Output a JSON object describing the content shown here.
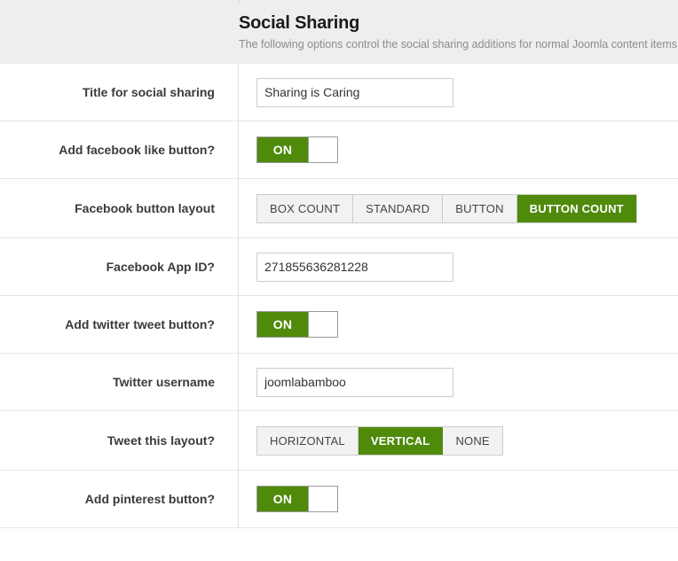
{
  "header": {
    "title": "Social Sharing",
    "description": "The following options control the social sharing additions for normal Joomla content items. T"
  },
  "colors": {
    "accent_green": "#4f8a0b",
    "header_band": "#eeeeee",
    "row_border": "#e6e6e6",
    "input_border": "#cccccc"
  },
  "rows": {
    "title_social_sharing": {
      "label": "Title for social sharing",
      "value": "Sharing is Caring",
      "placeholder": ""
    },
    "facebook_like": {
      "label": "Add facebook like button?",
      "state": "ON"
    },
    "facebook_layout": {
      "label": "Facebook button layout",
      "options": [
        "BOX COUNT",
        "STANDARD",
        "BUTTON",
        "BUTTON COUNT"
      ],
      "selected": "BUTTON COUNT"
    },
    "facebook_app_id": {
      "label": "Facebook App ID?",
      "value": "271855636281228",
      "placeholder": ""
    },
    "twitter_tweet": {
      "label": "Add twitter tweet button?",
      "state": "ON"
    },
    "twitter_username": {
      "label": "Twitter username",
      "value": "joomlabamboo",
      "placeholder": ""
    },
    "tweet_layout": {
      "label": "Tweet this layout?",
      "options": [
        "HORIZONTAL",
        "VERTICAL",
        "NONE"
      ],
      "selected": "VERTICAL"
    },
    "pinterest": {
      "label": "Add pinterest button?",
      "state": "ON"
    }
  }
}
